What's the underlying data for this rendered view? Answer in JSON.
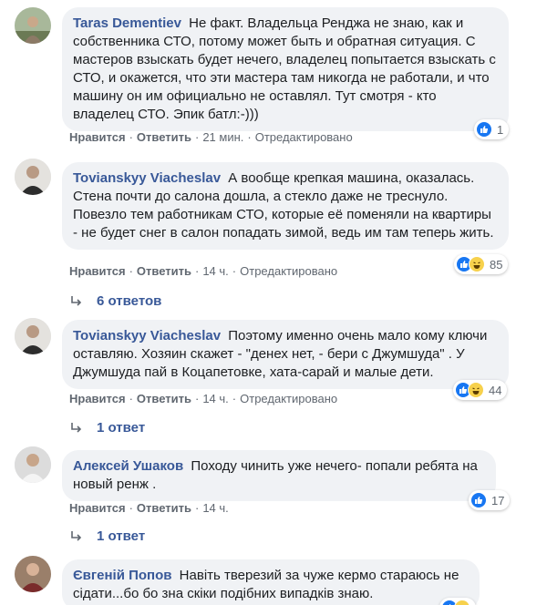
{
  "action_labels": {
    "like": "Нравится",
    "reply": "Ответить",
    "edited": "Отредактировано",
    "separator": "·"
  },
  "comments": [
    {
      "author": "Taras Dementiev",
      "text": "Не факт. Владельца Ренджа не знаю, как и собственника СТО, потому может быть и обратная ситуация. С мастеров взыскать будет нечего, владелец попытается взыскать с СТО, и окажется, что эти мастера там никогда не работали, и что машину он им официально не оставлял. Тут смотря - кто владелец СТО. Эпик батл:-)))",
      "time": "21 мин.",
      "reaction_icons": [
        "like-icon"
      ],
      "reaction_count": "1"
    },
    {
      "author": "Tovianskyy Viacheslav",
      "text": "А вообще крепкая машина, оказалась. Стена почти до салона дошла, а стекло даже не треснуло. Повезло тем работникам СТО, которые её поменяли на квартиры - не будет снег в салон попадать зимой, ведь им там теперь жить.",
      "time": "14 ч.",
      "reaction_icons": [
        "like-icon",
        "haha-icon"
      ],
      "reaction_count": "85",
      "replies": "6 ответов"
    },
    {
      "author": "Tovianskyy Viacheslav",
      "text": "Поэтому именно очень мало кому ключи оставляю. Хозяин скажет - \"денех нет, - бери с Джумшуда\" . У Джумшуда пай в Коцапетовке, хата-сарай и малые дети.",
      "time": "14 ч.",
      "reaction_icons": [
        "like-icon",
        "haha-icon"
      ],
      "reaction_count": "44",
      "replies": "1 ответ"
    },
    {
      "author": "Алексей Ушаков",
      "text": "Походу чинить уже нечего- попали ребята на новый ренж .",
      "time": "14 ч.",
      "reaction_icons": [
        "like-icon"
      ],
      "reaction_count": "17",
      "replies": "1 ответ"
    },
    {
      "author": "Євгеній Попов",
      "text": "Навіть тверезий за чуже кермо стараюсь не сідати...бо бо зна скіки подібних випадків знаю.",
      "reaction_icons": [
        "like-icon",
        "haha-icon"
      ]
    }
  ],
  "colors": {
    "author": "#385898",
    "bubble": "#f0f2f5",
    "like": "#1877f2",
    "haha": "#f7d14c",
    "meta": "#606770"
  }
}
